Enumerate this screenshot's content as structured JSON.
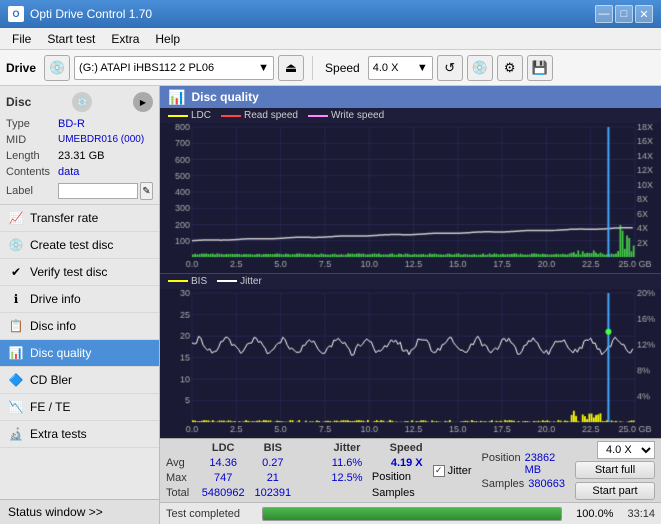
{
  "titlebar": {
    "title": "Opti Drive Control 1.70",
    "minimize": "—",
    "maximize": "□",
    "close": "✕"
  },
  "menu": {
    "items": [
      "File",
      "Start test",
      "Extra",
      "Help"
    ]
  },
  "toolbar": {
    "drive_label": "Drive",
    "drive_value": "(G:) ATAPI iHBS112  2 PL06",
    "speed_label": "Speed",
    "speed_value": "4.0 X"
  },
  "disc_panel": {
    "label": "Disc",
    "type_key": "Type",
    "type_val": "BD-R",
    "mid_key": "MID",
    "mid_val": "UMEBDR016 (000)",
    "length_key": "Length",
    "length_val": "23.31 GB",
    "contents_key": "Contents",
    "contents_val": "data",
    "label_key": "Label",
    "label_placeholder": ""
  },
  "nav_items": [
    {
      "id": "transfer-rate",
      "label": "Transfer rate",
      "icon": "📈"
    },
    {
      "id": "create-test-disc",
      "label": "Create test disc",
      "icon": "💿"
    },
    {
      "id": "verify-test-disc",
      "label": "Verify test disc",
      "icon": "✔"
    },
    {
      "id": "drive-info",
      "label": "Drive info",
      "icon": "ℹ"
    },
    {
      "id": "disc-info",
      "label": "Disc info",
      "icon": "📋"
    },
    {
      "id": "disc-quality",
      "label": "Disc quality",
      "icon": "📊",
      "active": true
    },
    {
      "id": "cd-bier",
      "label": "CD Bler",
      "icon": "🔷"
    },
    {
      "id": "fe-te",
      "label": "FE / TE",
      "icon": "📉"
    },
    {
      "id": "extra-tests",
      "label": "Extra tests",
      "icon": "🔬"
    }
  ],
  "status_window": "Status window >>",
  "dq_header": "Disc quality",
  "chart1": {
    "legend": [
      {
        "color": "#ffff00",
        "label": "LDC"
      },
      {
        "color": "#ff4444",
        "label": "Read speed"
      },
      {
        "color": "#ff44ff",
        "label": "Write speed"
      }
    ],
    "y_max": 800,
    "y_labels_left": [
      "800",
      "700",
      "600",
      "500",
      "400",
      "300",
      "200",
      "100"
    ],
    "y_labels_right": [
      "18X",
      "16X",
      "14X",
      "12X",
      "10X",
      "8X",
      "6X",
      "4X",
      "2X"
    ],
    "x_labels": [
      "0.0",
      "2.5",
      "5.0",
      "7.5",
      "10.0",
      "12.5",
      "15.0",
      "17.5",
      "20.0",
      "22.5",
      "25.0 GB"
    ]
  },
  "chart2": {
    "legend": [
      {
        "color": "#ffff00",
        "label": "BIS"
      },
      {
        "color": "#ffffff",
        "label": "Jitter"
      }
    ],
    "y_max": 30,
    "y_labels_left": [
      "30",
      "25",
      "20",
      "15",
      "10",
      "5"
    ],
    "y_labels_right": [
      "20%",
      "16%",
      "12%",
      "8%",
      "4%"
    ],
    "x_labels": [
      "0.0",
      "2.5",
      "5.0",
      "7.5",
      "10.0",
      "12.5",
      "15.0",
      "17.5",
      "20.0",
      "22.5",
      "25.0 GB"
    ]
  },
  "stats": {
    "ldc_label": "LDC",
    "bis_label": "BIS",
    "jitter_label": "Jitter",
    "speed_label": "Speed",
    "avg_label": "Avg",
    "max_label": "Max",
    "total_label": "Total",
    "ldc_avg": "14.36",
    "ldc_max": "747",
    "ldc_total": "5480962",
    "bis_avg": "0.27",
    "bis_max": "21",
    "bis_total": "102391",
    "jitter_checked": true,
    "jitter_avg": "11.6%",
    "jitter_max": "12.5%",
    "speed_val": "4.19 X",
    "speed_dropdown": "4.0 X",
    "position_label": "Position",
    "position_val": "23862 MB",
    "samples_label": "Samples",
    "samples_val": "380663"
  },
  "buttons": {
    "start_full": "Start full",
    "start_part": "Start part"
  },
  "progress": {
    "value": 100,
    "text": "100.0%",
    "status": "Test completed",
    "time": "33:14"
  }
}
